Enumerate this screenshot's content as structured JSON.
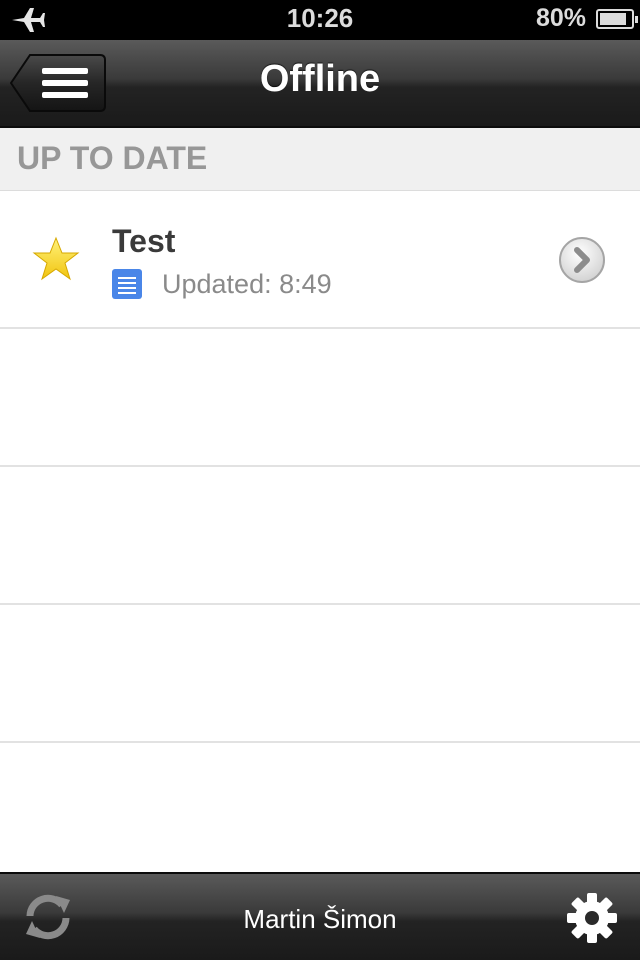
{
  "status_bar": {
    "time": "10:26",
    "battery_percent": "80%",
    "battery_level": 0.8,
    "airplane_icon": "airplane-icon"
  },
  "nav": {
    "title": "Offline",
    "menu_icon": "hamburger-menu-icon"
  },
  "section": {
    "header": "UP TO DATE"
  },
  "documents": [
    {
      "title": "Test",
      "updated": "Updated: 8:49",
      "starred": true,
      "type_icon": "document-icon"
    }
  ],
  "toolbar": {
    "user_name": "Martin Šimon",
    "refresh_icon": "refresh-icon",
    "settings_icon": "gear-icon"
  },
  "colors": {
    "star": "#f7d21a",
    "doc_icon": "#4a86e8",
    "section_text": "#979797"
  }
}
